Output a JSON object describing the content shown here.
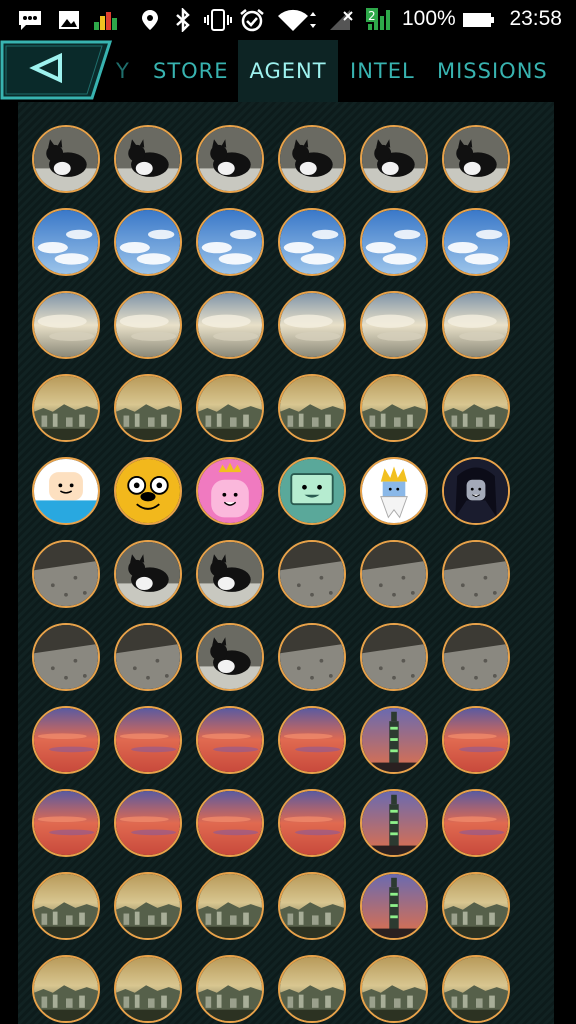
{
  "status_bar": {
    "battery_percent": "100%",
    "time": "23:58",
    "icons": [
      "chat-icon",
      "image-icon",
      "equalizer-icon",
      "location-icon",
      "bluetooth-icon",
      "vibrate-icon",
      "alarm-icon",
      "wifi-icon",
      "signal-off-icon",
      "signal-icon",
      "battery-icon"
    ]
  },
  "nav": {
    "tabs": [
      {
        "label": "Y"
      },
      {
        "label": "STORE"
      },
      {
        "label": "AGENT"
      },
      {
        "label": "INTEL"
      },
      {
        "label": "MISSIONS"
      }
    ],
    "active_tab": "AGENT"
  },
  "colors": {
    "accent": "#38b3b0",
    "active_text": "#9ef2ef",
    "ring": "#e8a24a"
  },
  "avatar_grid": {
    "rows": [
      {
        "theme": "cat-photos",
        "items": [
          "cat-icon",
          "cat-icon",
          "cat-icon",
          "cat-icon",
          "cat-icon",
          "cat-icon"
        ]
      },
      {
        "theme": "sky-photos",
        "items": [
          "sky-icon",
          "sky-icon",
          "sky-icon",
          "sky-icon",
          "sky-icon",
          "sky-icon"
        ]
      },
      {
        "theme": "cloud-photos",
        "items": [
          "cloud-icon",
          "cloud-icon",
          "cloud-icon",
          "cloud-icon",
          "cloud-icon",
          "cloud-icon"
        ]
      },
      {
        "theme": "city-view-photos",
        "items": [
          "city-icon",
          "city-icon",
          "city-icon",
          "city-icon",
          "city-icon",
          "city-icon"
        ]
      },
      {
        "theme": "cartoon-characters",
        "items": [
          "finn-icon",
          "jake-icon",
          "princess-bubblegum-icon",
          "bmo-icon",
          "ice-king-icon",
          "marceline-icon"
        ]
      },
      {
        "theme": "stone-cat-photos",
        "items": [
          "stone-icon",
          "cat-icon",
          "cat-icon",
          "stone-icon",
          "stone-icon",
          "stone-icon"
        ]
      },
      {
        "theme": "stone-photos",
        "items": [
          "stone-icon",
          "stone-icon",
          "cat-icon",
          "stone-icon",
          "stone-icon",
          "stone-icon"
        ]
      },
      {
        "theme": "sunset-photos",
        "items": [
          "sunset-icon",
          "sunset-icon",
          "sunset-icon",
          "sunset-icon",
          "tower-icon",
          "sunset-icon"
        ]
      },
      {
        "theme": "red-sunset-photos",
        "items": [
          "sunset-icon",
          "sunset-icon",
          "sunset-icon",
          "sunset-icon",
          "tower-icon",
          "sunset-icon"
        ]
      },
      {
        "theme": "city-dusk-photos",
        "items": [
          "city-icon",
          "city-icon",
          "city-icon",
          "city-icon",
          "tower-icon",
          "city-icon"
        ]
      },
      {
        "theme": "city-night-photos",
        "items": [
          "city-icon",
          "city-icon",
          "city-icon",
          "city-icon",
          "city-icon",
          "city-icon"
        ]
      }
    ]
  }
}
